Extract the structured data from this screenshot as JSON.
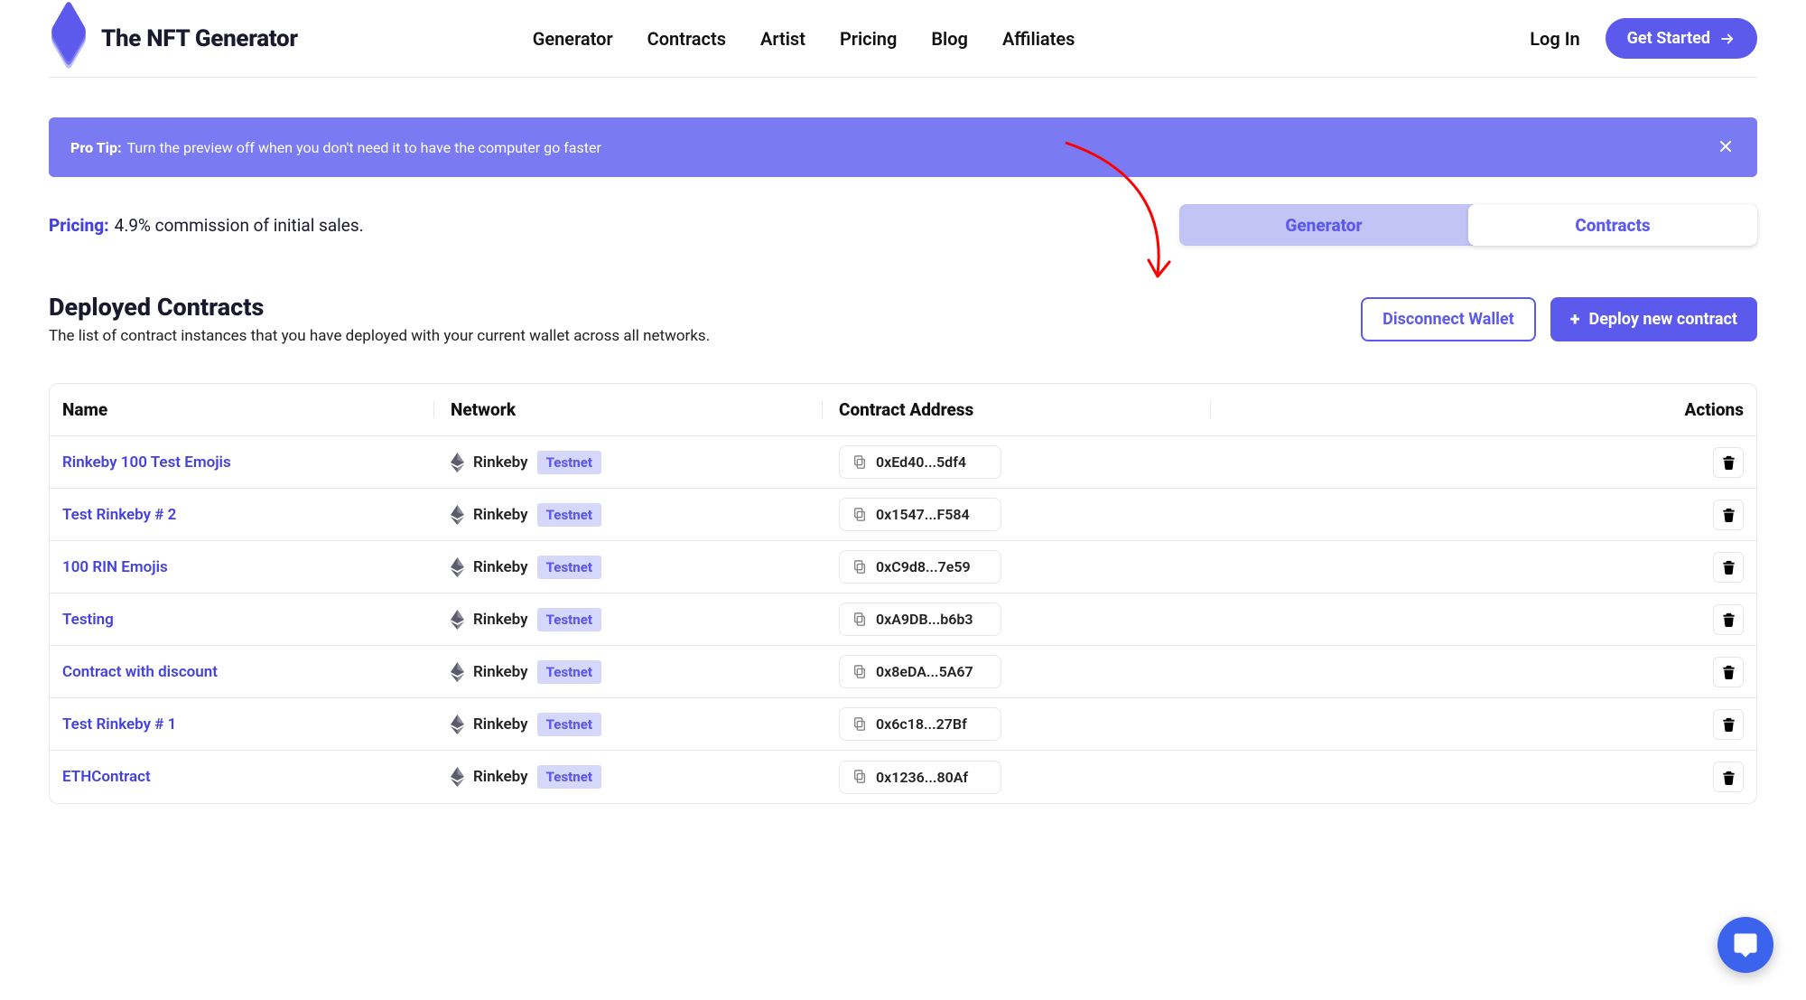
{
  "brand": {
    "name": "The NFT Generator"
  },
  "nav": {
    "links": [
      "Generator",
      "Contracts",
      "Artist",
      "Pricing",
      "Blog",
      "Affiliates"
    ],
    "login": "Log In",
    "cta": "Get Started"
  },
  "tip": {
    "label": "Pro Tip:",
    "text": "Turn the preview off when you don't need it to have the computer go faster"
  },
  "pricing": {
    "label": "Pricing:",
    "text": "4.9% commission of initial sales."
  },
  "toggle": {
    "generator": "Generator",
    "contracts": "Contracts",
    "active": "contracts"
  },
  "section": {
    "title": "Deployed Contracts",
    "subtitle": "The list of contract instances that you have deployed with your current wallet across all networks.",
    "disconnect": "Disconnect Wallet",
    "deploy": "Deploy new contract"
  },
  "table": {
    "headers": {
      "name": "Name",
      "network": "Network",
      "address": "Contract Address",
      "actions": "Actions"
    },
    "network_name": "Rinkeby",
    "badge": "Testnet",
    "rows": [
      {
        "name": "Rinkeby 100 Test Emojis",
        "address": "0xEd40...5df4"
      },
      {
        "name": "Test Rinkeby # 2",
        "address": "0x1547...F584"
      },
      {
        "name": "100 RIN Emojis",
        "address": "0xC9d8...7e59"
      },
      {
        "name": "Testing",
        "address": "0xA9DB...b6b3"
      },
      {
        "name": "Contract with discount",
        "address": "0x8eDA...5A67"
      },
      {
        "name": "Test Rinkeby # 1",
        "address": "0x6c18...27Bf"
      },
      {
        "name": "ETHContract",
        "address": "0x1236...80Af"
      }
    ]
  }
}
